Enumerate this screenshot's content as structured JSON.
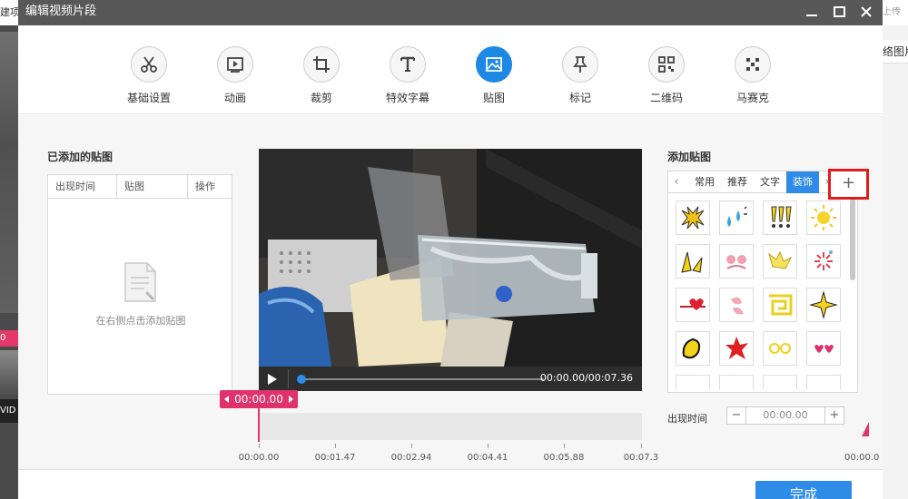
{
  "background": {
    "left_top_text": "建项",
    "right_top_text": "上传",
    "right_tab_text": "络图片",
    "left_red_text": "0",
    "left_strip_text": "VID"
  },
  "window": {
    "title": "编辑视频片段",
    "minimize_icon": "minimize-icon",
    "maximize_icon": "maximize-icon",
    "close_icon": "close-icon"
  },
  "toolbar": {
    "items": [
      {
        "label": "基础设置",
        "icon": "scissors-icon",
        "active": false
      },
      {
        "label": "动画",
        "icon": "play-frame-icon",
        "active": false
      },
      {
        "label": "裁剪",
        "icon": "crop-icon",
        "active": false
      },
      {
        "label": "特效字幕",
        "icon": "text-icon",
        "active": false
      },
      {
        "label": "贴图",
        "icon": "image-icon",
        "active": true
      },
      {
        "label": "标记",
        "icon": "pin-icon",
        "active": false
      },
      {
        "label": "二维码",
        "icon": "qrcode-icon",
        "active": false
      },
      {
        "label": "马赛克",
        "icon": "mosaic-icon",
        "active": false
      }
    ]
  },
  "left_panel": {
    "title": "已添加的贴图",
    "columns": [
      "出现时间",
      "贴图",
      "操作"
    ],
    "empty_text": "在右侧点击添加贴图"
  },
  "player": {
    "time": "00:00.00/00:07.36",
    "progress": 0
  },
  "timeline": {
    "current": "00:00.00",
    "ticks": [
      "00:00.00",
      "00:01.47",
      "00:02.94",
      "00:04.41",
      "00:05.88",
      "00:07.3"
    ],
    "right_tick": "00:00.0"
  },
  "right_panel": {
    "title": "添加贴图",
    "tabs": [
      "常用",
      "推荐",
      "文字",
      "装饰"
    ],
    "active_tab": "装饰",
    "add_label": "+",
    "appear_label": "出现时间",
    "appear_value": "00:00.00",
    "minus": "−",
    "plus": "+"
  },
  "footer": {
    "done_label": "完成"
  },
  "colors": {
    "accent": "#2e8ce8",
    "marker": "#e0336d",
    "highlight": "#e01d1d"
  }
}
